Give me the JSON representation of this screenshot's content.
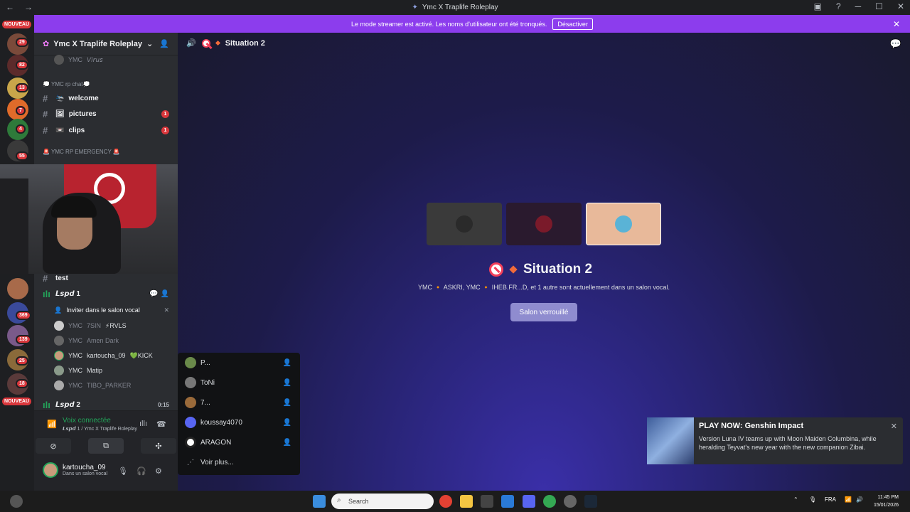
{
  "window": {
    "title": "Ymc X Traplife Roleplay",
    "back": "←",
    "fwd": "→"
  },
  "banner": {
    "text": "Le mode streamer est activé. Les noms d'utilisateur ont été tronqués.",
    "button": "Désactiver",
    "close": "✕"
  },
  "rail": {
    "new_top": "NOUVEAU",
    "new_bottom": "NOUVEAU",
    "badges": [
      "29",
      "82",
      "13",
      "7",
      "4",
      "55",
      "369",
      "139",
      "25",
      "18"
    ]
  },
  "server": {
    "name": "Ymc X Traplife Roleplay",
    "chevron": "⌄"
  },
  "sidebar": {
    "member_virus": {
      "prefix": "YMC",
      "name": "𝘝𝘪𝘳𝘶𝘴"
    },
    "cat_chat": "💭 YMC rp chat💭",
    "channels": [
      {
        "name": "welcome",
        "emoji": "🛬",
        "unread": ""
      },
      {
        "name": "pictures",
        "emoji": "🖼",
        "unread": "1"
      },
      {
        "name": "clips",
        "emoji": "📼",
        "unread": "1"
      }
    ],
    "cat_emergency": "🚨 YMC RP EMERGENCY 🚨",
    "chan_test": "test",
    "voice_lspd1": "𝙇𝙨𝙥𝙙 1",
    "invite_label": "Inviter dans le salon vocal",
    "members": [
      {
        "prefix": "YMC",
        "name": "7SIN",
        "tag": "⚡RVLS"
      },
      {
        "prefix": "YMC",
        "name": "Amen Dark",
        "tag": ""
      },
      {
        "prefix": "YMC",
        "name": "kartoucha_09",
        "tag": "💚KICK"
      },
      {
        "prefix": "YMC",
        "name": "Matip",
        "tag": ""
      },
      {
        "prefix": "YMC",
        "name": "TIBO_PARKER",
        "tag": ""
      }
    ],
    "voice_lspd2": "𝙇𝙨𝙥𝙙 2",
    "lspd2_time": "0:15"
  },
  "voice": {
    "status": "Voix connectée",
    "sub": "𝙇𝙨𝙥𝙙 1 / Ymc X Traplife Roleplay"
  },
  "user": {
    "name": "kartoucha_09",
    "status": "Dans un salon vocal"
  },
  "stage": {
    "channel": "Situation 2",
    "title": "Situation 2",
    "sub": "YMC 🔸 ASKRI, YMC 🔸 IHEB.FR...D, et 1 autre sont actuellement dans un salon vocal.",
    "locked": "Salon verrouillé"
  },
  "popup": {
    "items": [
      "P...",
      "ToNi",
      "7...",
      "koussay4070",
      "ARAGON"
    ],
    "more": "Voir plus..."
  },
  "toast": {
    "title": "PLAY NOW: Genshin Impact",
    "body": "Version Luna IV teams up with Moon Maiden Columbina, while heralding Teyvat's new year with the new companion Zibai."
  },
  "taskbar": {
    "search": "Search",
    "lang": "FRA",
    "time": "11:45 PM",
    "date": "15/01/2026"
  }
}
